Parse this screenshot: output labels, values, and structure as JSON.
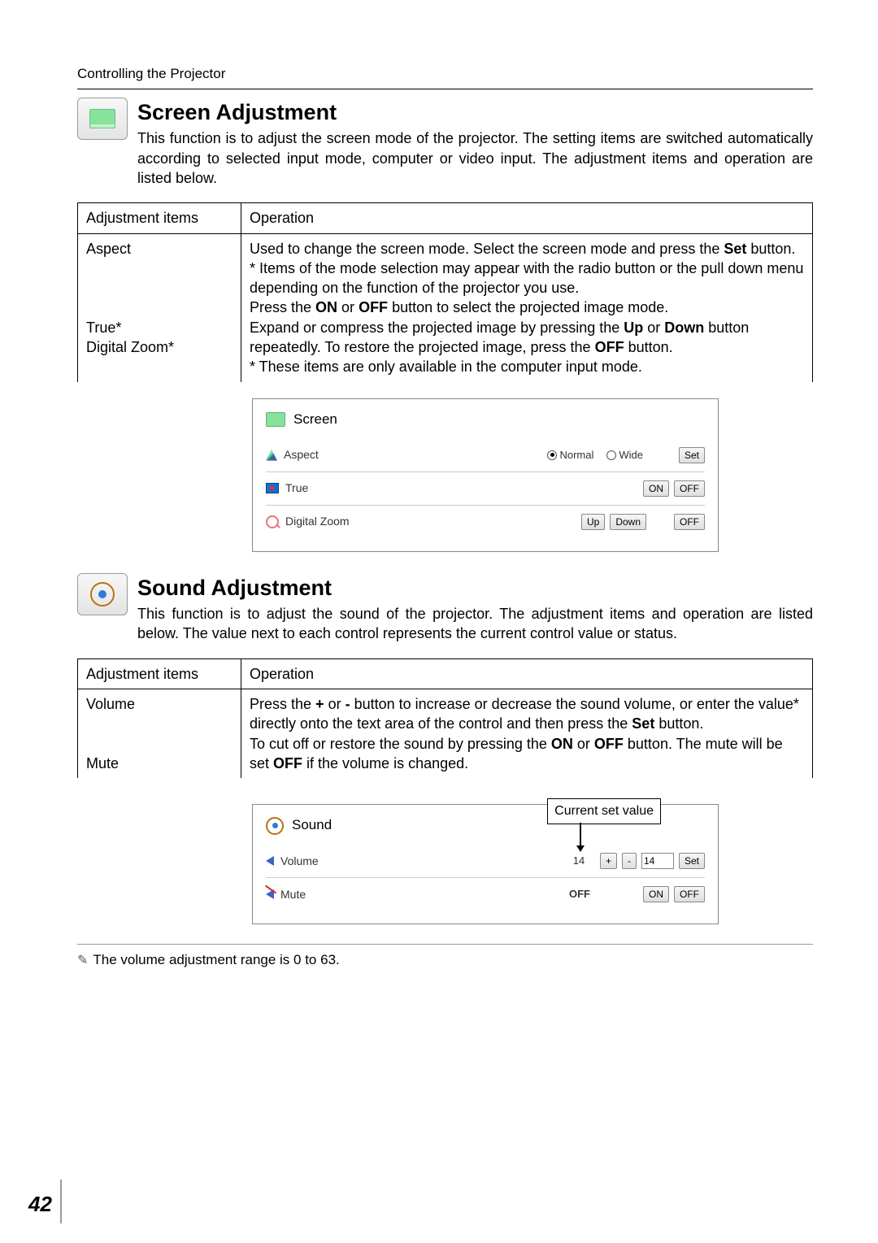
{
  "header": {
    "breadcrumb": "Controlling the Projector"
  },
  "screen": {
    "title": "Screen Adjustment",
    "desc": "This function is to adjust the screen mode of the projector. The setting items are switched automatically according to selected input mode, computer or video input. The adjustment items and operation are listed below.",
    "table": {
      "h1": "Adjustment items",
      "h2": "Operation",
      "rows": [
        {
          "item": "Aspect",
          "op_pre": "Used to change the screen mode. Select the screen mode and press the ",
          "op_b1": "Set",
          "op_mid": " button. * Items of the mode selection may appear with the radio button or the pull down menu depending on the function of the projector you use."
        },
        {
          "item": "True*",
          "op_pre": "Press the ",
          "op_b1": "ON",
          "op_mid": " or ",
          "op_b2": "OFF",
          "op_post": " button to select the projected image mode."
        },
        {
          "item": "Digital Zoom*",
          "op_pre": "Expand or compress the projected image by pressing the ",
          "op_b1": "Up",
          "op_mid": " or ",
          "op_b2": "Down",
          "op_post": " button repeatedly. To restore the projected image, press the ",
          "op_b3": "OFF",
          "op_post2": " button.",
          "footnote": "* These items are only available in the computer input mode."
        }
      ]
    },
    "panel": {
      "title": "Screen",
      "aspect": {
        "label": "Aspect",
        "opt_normal": "Normal",
        "opt_wide": "Wide",
        "set": "Set"
      },
      "true_row": {
        "label": "True",
        "on": "ON",
        "off": "OFF"
      },
      "zoom": {
        "label": "Digital Zoom",
        "up": "Up",
        "down": "Down",
        "off": "OFF"
      }
    }
  },
  "sound": {
    "title": "Sound Adjustment",
    "desc": "This function is to adjust the sound of the projector. The adjustment items and operation are listed below. The value next to each control represents the current control value or status.",
    "table": {
      "h1": "Adjustment items",
      "h2": "Operation",
      "rows": [
        {
          "item": "Volume",
          "op_pre": "Press the ",
          "op_b1": "+",
          "op_mid": " or ",
          "op_b2": "-",
          "op_post": " button to increase or decrease the sound volume, or enter the value* directly onto the text area of the control and then press the ",
          "op_b3": "Set",
          "op_post2": " button."
        },
        {
          "item": "Mute",
          "op_pre": "To cut off or restore the sound by pressing the ",
          "op_b1": "ON",
          "op_mid": " or ",
          "op_b2": "OFF",
          "op_post": " button. The mute will be set ",
          "op_b3": "OFF",
          "op_post2": " if the volume is changed."
        }
      ]
    },
    "panel": {
      "title": "Sound",
      "callout": "Current set value",
      "volume": {
        "label": "Volume",
        "current": "14",
        "plus": "+",
        "minus": "-",
        "value": "14",
        "set": "Set"
      },
      "mute": {
        "label": "Mute",
        "status": "OFF",
        "on": "ON",
        "off": "OFF"
      }
    }
  },
  "footnote": "The volume adjustment range is 0 to 63.",
  "page_number": "42"
}
